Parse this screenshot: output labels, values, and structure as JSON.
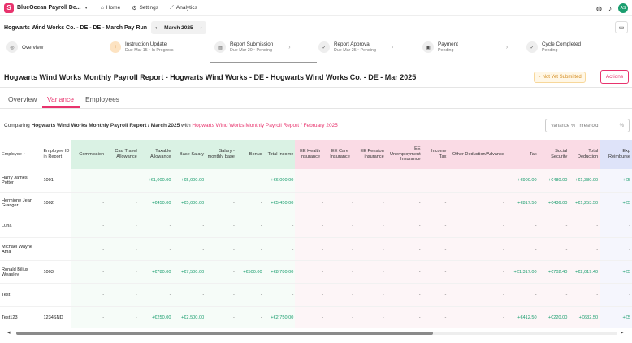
{
  "app": {
    "name": "BlueOcean Payroll De...",
    "logo_letter": "S"
  },
  "nav": {
    "home": "Home",
    "settings": "Settings",
    "analytics": "Analytics"
  },
  "user": {
    "initials": "AS"
  },
  "payrun": {
    "title": "Hogwarts Wind Works Co. - DE - DE - March Pay Run",
    "month": "March 2025"
  },
  "steps": [
    {
      "title": "Overview",
      "sub": ""
    },
    {
      "title": "Instruction Update",
      "sub": "Due Mar 15 • In Progress"
    },
    {
      "title": "Report Submission",
      "sub": "Due Mar 20 • Pending"
    },
    {
      "title": "Report Approval",
      "sub": "Due Mar 25 • Pending"
    },
    {
      "title": "Payment",
      "sub": "Pending"
    },
    {
      "title": "Cycle Completed",
      "sub": "Pending"
    }
  ],
  "report": {
    "title": "Hogwarts Wind Works Monthly Payroll Report - Hogwarts Wind Works - DE - Hogwarts Wind Works Co. - DE - Mar 2025",
    "status": "Not Yet Submitted",
    "actions_label": "Actions"
  },
  "tabs": [
    "Overview",
    "Variance",
    "Employees"
  ],
  "compare": {
    "prefix": "Comparing",
    "current": "Hogwarts Wind Works Monthly Payroll Report / March 2025",
    "with": "with",
    "previous": "Hogwarts Wind Works Monthly Payroll Report / February 2025"
  },
  "threshold": {
    "placeholder": "Variance % Threshold",
    "unit": "%"
  },
  "table": {
    "headers": [
      "Employee ↑",
      "Employee ID in Report",
      "Commission",
      "Car/ Travel Allowance",
      "Taxable Allowance",
      "Base Salary",
      "Salary - monthly base",
      "Bonus",
      "Total Income",
      "EE Health Insurance",
      "EE Care Insurance",
      "EE Pension insurance",
      "EE Unemployment Insurance",
      "Income Tax",
      "Other Deduction/Advance",
      "Tax",
      "Social Security",
      "Total Deduction",
      "Exp Reimburse"
    ],
    "rows": [
      [
        "Harry James Potter",
        "1001",
        "-",
        "-",
        "+€1,000.00",
        "+€5,000.00",
        "-",
        "-",
        "+€6,000.00",
        "-",
        "-",
        "-",
        "-",
        "-",
        "-",
        "+€900.00",
        "+€480.00",
        "+€1,380.00",
        "+€5"
      ],
      [
        "Hermione Jean Granger",
        "1002",
        "-",
        "-",
        "+€450.00",
        "+€5,000.00",
        "-",
        "-",
        "+€5,450.00",
        "-",
        "-",
        "-",
        "-",
        "-",
        "-",
        "+€817.50",
        "+€436.00",
        "+€1,253.50",
        "+€5"
      ],
      [
        "Luna",
        "",
        "-",
        "-",
        "-",
        "-",
        "-",
        "-",
        "-",
        "-",
        "-",
        "-",
        "-",
        "-",
        "-",
        "-",
        "-",
        "-",
        "-"
      ],
      [
        "Michael Wayne Atha",
        "",
        "-",
        "-",
        "-",
        "-",
        "-",
        "-",
        "-",
        "-",
        "-",
        "-",
        "-",
        "-",
        "-",
        "-",
        "-",
        "-",
        "-"
      ],
      [
        "Ronald Bilius Weasley",
        "1003",
        "-",
        "-",
        "+€780.00",
        "+€7,500.00",
        "-",
        "+€500.00",
        "+€8,780.00",
        "-",
        "-",
        "-",
        "-",
        "-",
        "-",
        "+€1,317.00",
        "+€702.40",
        "+€2,019.40",
        "+€5"
      ],
      [
        "Test",
        "",
        "-",
        "-",
        "-",
        "-",
        "-",
        "-",
        "-",
        "-",
        "-",
        "-",
        "-",
        "-",
        "-",
        "-",
        "-",
        "-",
        "-"
      ],
      [
        "Test123",
        "1234SND",
        "-",
        "-",
        "+€250.00",
        "+€2,500.00",
        "-",
        "-",
        "+€2,750.00",
        "-",
        "-",
        "-",
        "-",
        "-",
        "-",
        "+€412.50",
        "+€220.00",
        "+€632.50",
        "+€5"
      ]
    ]
  },
  "colors": {
    "accent": "#e8336d",
    "income": "#daf2e4",
    "deduction": "#fadbe5",
    "reimbursement": "#dee3f9"
  },
  "icons": {
    "home": "home-icon",
    "settings": "gear-icon",
    "analytics": "chart-icon"
  }
}
